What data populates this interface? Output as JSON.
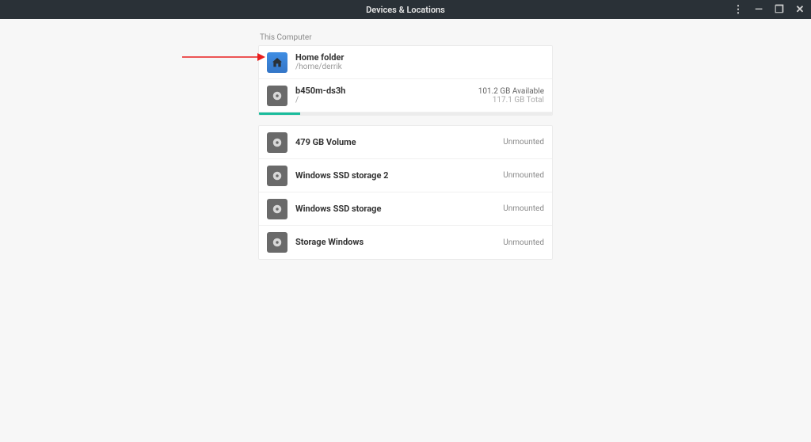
{
  "titlebar": {
    "title": "Devices & Locations"
  },
  "section": {
    "label": "This Computer"
  },
  "home": {
    "title": "Home folder",
    "path": "/home/derrik"
  },
  "root": {
    "name": "b450m-ds3h",
    "path": "/",
    "available": "101.2 GB Available",
    "total": "117.1 GB Total",
    "used_percent": 14
  },
  "volumes": [
    {
      "name": "479 GB Volume",
      "status": "Unmounted"
    },
    {
      "name": "Windows SSD storage 2",
      "status": "Unmounted"
    },
    {
      "name": "Windows SSD storage",
      "status": "Unmounted"
    },
    {
      "name": "Storage Windows",
      "status": "Unmounted"
    }
  ]
}
